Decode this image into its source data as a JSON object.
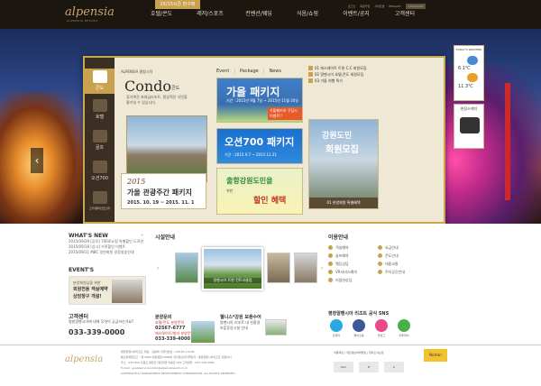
{
  "header": {
    "logo": "alpensia",
    "logo_sub": "ALPENSIA RESORT",
    "promo": "15/15시즌 판구매",
    "nav": [
      "호텔/콘도",
      "레저/스포츠",
      "컨벤션/웨딩",
      "식음/쇼핑",
      "이벤트/공지",
      "고객센터"
    ],
    "toplinks": [
      "로그인",
      "회원가입",
      "사이트맵",
      "ENGLISH"
    ],
    "language_btn": "LANGUAGE"
  },
  "hero": {
    "prev_arrow": "‹",
    "next_arrow": "›"
  },
  "panel": {
    "side_items": [
      {
        "label": "콘도",
        "icon": "building-icon"
      },
      {
        "label": "호텔",
        "icon": "hotel-icon"
      },
      {
        "label": "골프",
        "icon": "golf-icon"
      },
      {
        "label": "오션700",
        "icon": "wave-icon"
      },
      {
        "label": "스키/알파인코스터",
        "icon": "ski-icon"
      }
    ],
    "brand_line": "ALPENSIA 평창시작",
    "condo_title": "Condo",
    "condo_sub": "콘도",
    "condo_desc": "휴가촉진 초대급리조트, 환상적인 낙민을 즐기실 수 있습니다.",
    "tourweek": {
      "year": "2015",
      "title": "가을 관광주간 패키지",
      "date": "2015. 10. 19 ~ 2015. 11. 1"
    },
    "tabs": [
      "Event",
      "Package",
      "News"
    ],
    "banner1": {
      "title": "가을 패키지",
      "sub": "기간 : 2015년 9월 7일 ~ 2015년 11월 30일",
      "badge": "가을패키지 구입시 이벤트!!"
    },
    "banner2": {
      "title": "오션700 패키지",
      "sub": "기간 : 2015.9.7 ~ 2015.12.31"
    },
    "banner3": {
      "t1": "출항강원도민을",
      "t2": "위한",
      "t3": "할인 혜택"
    },
    "list": [
      "01 에스테이트 트윈 C.C 회원모집",
      "02 알펜시아 호텔,콘도 회원모집",
      "03 가을 여행 특가"
    ],
    "banner4": {
      "t1": "강원도민",
      "t2": "회원모집",
      "bar": "01 분양회원 특별혜택"
    }
  },
  "weather": {
    "title": "TODAY'S WEATHER",
    "label1": "대관령",
    "temp1": "6.1℃",
    "label2": "강릉",
    "temp2": "11.3℃"
  },
  "webcam": {
    "title": "현장스케치"
  },
  "lower": {
    "whats_new_title": "WHAT'S NEW",
    "news": [
      "2015/09/29 [공모] 700로쇼핑 특별할인 도로연",
      "2015/09/18 [상시] 가족할인 이벤트",
      "2015/09/11 MBC 일반회원 갈증방송안내"
    ],
    "more": "+",
    "events_title": "EVENT'S",
    "event_line": "분양회원님을 위한",
    "event_big1": "회원전용 객실예약",
    "event_big2": "상담창구 개설!",
    "customer_title": "고객센터",
    "customer_hours": "평창알펜시아에 대해 무엇이 궁금하신가요?",
    "customer_number": "033-339-0000",
    "gallery_title": "시설안내",
    "gallery_caption": "알펜시아 트윈 컨트리클럽",
    "gallery_prev": "‹",
    "gallery_next": "›",
    "bunyang": {
      "title": "분양문의",
      "l1": "호텔/콘도 분양문의",
      "l2": "02567-6777",
      "l3": "에스테이트/빌라 분양문의",
      "n": "033-339-4000"
    },
    "welfare": {
      "title": "웰니스*강원 보훈수어",
      "l1": "알펜시아 리조트 내 친환경",
      "l2": "보훈휴양시설 안내"
    },
    "guide_title": "이용안내",
    "guide_items": [
      "객실예약",
      "요금안내",
      "골프예약",
      "콘도안내",
      "웨딩상담",
      "대중교통",
      "VR서비스예약",
      "주차공간안내",
      "리셉션상담",
      ""
    ],
    "sns_title": "평창알펜시아 리조트 공식 SNS",
    "sns": [
      {
        "label": "트위터",
        "color": "#29a9e1"
      },
      {
        "label": "페이스북",
        "color": "#3b5998"
      },
      {
        "label": "블로그",
        "color": "#e84a8a"
      },
      {
        "label": "미투데이",
        "color": "#4ab04a"
      }
    ]
  },
  "footer": {
    "logo": "alpensia",
    "line1": "평창알펜시아리조트 대표 : 김용택 사업자번호 : 226-82-13736",
    "line2": "통신판매업신고 : 제 2009-강원평창-0008호  개인정보관리책임자 : 평창알펜시아리조트 대표이사",
    "line3": "주소 : 232-950 강원도 평창군 대관령면 솔봉로 325  고객센터 : 033-339-0000",
    "line4": "E-mail : guestservicecenter@alpensiaresort.co.kr",
    "line5": "COPYRIGHT(C) GANGWONDO DEVELOPMENT CORPORATION. ALL RIGHTS RESERVED.",
    "links": "이용약관 | 개인정보처리방침 | 찾아오시는길",
    "badges": [
      "GDC",
      "M",
      "K"
    ],
    "norton": "Norton"
  }
}
